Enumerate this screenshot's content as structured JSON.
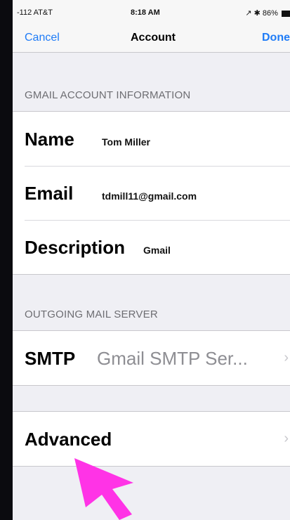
{
  "status_bar": {
    "carrier": "-112 AT&T",
    "time": "8:18 AM",
    "right": "↗ ✱ 86%"
  },
  "nav": {
    "cancel": "Cancel",
    "title": "Account",
    "done": "Done"
  },
  "section_account": {
    "header": "GMAIL ACCOUNT INFORMATION",
    "rows": [
      {
        "label": "Name",
        "value": "Tom Miller"
      },
      {
        "label": "Email",
        "value": "tdmill11@gmail.com"
      },
      {
        "label": "Description",
        "value": "Gmail"
      }
    ]
  },
  "section_outgoing": {
    "header": "OUTGOING MAIL SERVER",
    "rows": [
      {
        "label": "SMTP",
        "value": "Gmail SMTP Ser..."
      }
    ]
  },
  "section_advanced": {
    "rows": [
      {
        "label": "Advanced"
      }
    ]
  },
  "icons": {
    "wifi": "wifi-icon",
    "battery": "battery-icon",
    "chevron": "chevron-right-icon",
    "pointer": "pointer-arrow-icon"
  },
  "colors": {
    "accent": "#1f7cf7",
    "annotation_arrow": "#ff33e6",
    "background": "#efeff4"
  }
}
